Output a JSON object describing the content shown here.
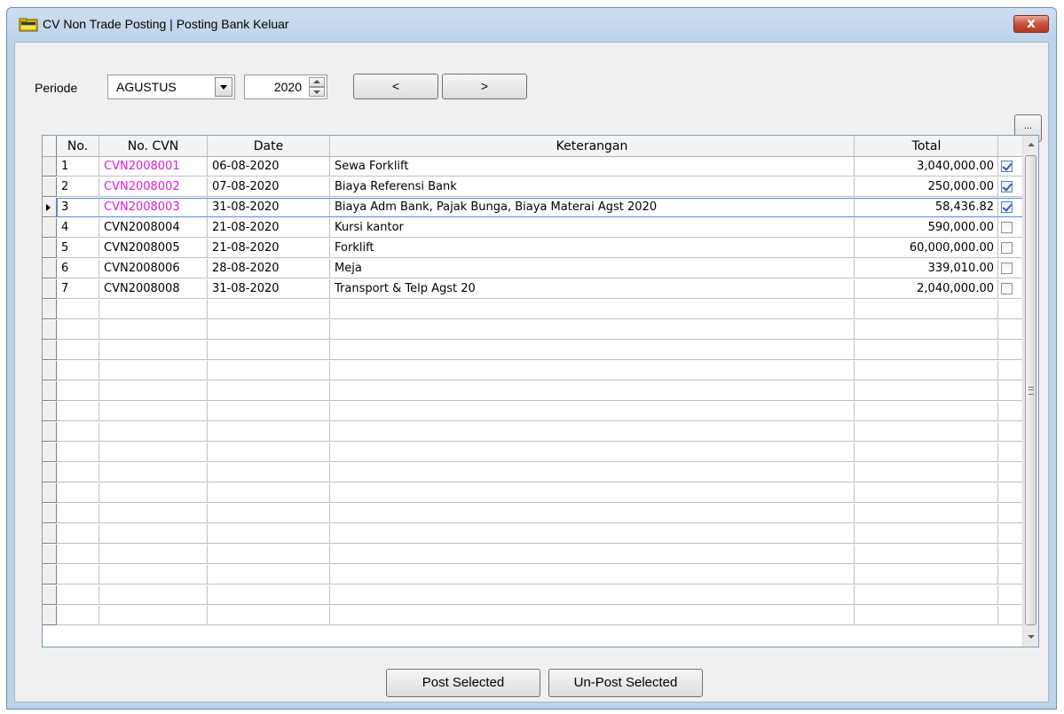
{
  "window": {
    "title": "CV Non Trade Posting | Posting Bank Keluar",
    "close_label": "x"
  },
  "toolbar": {
    "periode_label": "Periode",
    "month_value": "AGUSTUS",
    "year_value": "2020",
    "prev_label": "<",
    "next_label": ">",
    "more_label": "..."
  },
  "grid": {
    "columns": [
      "No.",
      "No. CVN",
      "Date",
      "Keterangan",
      "Total"
    ],
    "rows": [
      {
        "no": "1",
        "cvn": "CVN2008001",
        "date": "06-08-2020",
        "keterangan": "Sewa Forklift",
        "total": "3,040,000.00",
        "checked": true,
        "highlight": true
      },
      {
        "no": "2",
        "cvn": "CVN2008002",
        "date": "07-08-2020",
        "keterangan": "Biaya Referensi Bank",
        "total": "250,000.00",
        "checked": true,
        "highlight": true
      },
      {
        "no": "3",
        "cvn": "CVN2008003",
        "date": "31-08-2020",
        "keterangan": "Biaya Adm Bank, Pajak Bunga, Biaya Materai Agst 2020",
        "total": "58,436.82",
        "checked": true,
        "highlight": true,
        "current": true
      },
      {
        "no": "4",
        "cvn": "CVN2008004",
        "date": "21-08-2020",
        "keterangan": "Kursi kantor",
        "total": "590,000.00",
        "checked": false
      },
      {
        "no": "5",
        "cvn": "CVN2008005",
        "date": "21-08-2020",
        "keterangan": "Forklift",
        "total": "60,000,000.00",
        "checked": false
      },
      {
        "no": "6",
        "cvn": "CVN2008006",
        "date": "28-08-2020",
        "keterangan": "Meja",
        "total": "339,010.00",
        "checked": false
      },
      {
        "no": "7",
        "cvn": "CVN2008008",
        "date": "31-08-2020",
        "keterangan": "Transport & Telp Agst 20",
        "total": "2,040,000.00",
        "checked": false
      }
    ],
    "empty_rows": 16
  },
  "actions": {
    "post_label": "Post Selected",
    "unpost_label": "Un-Post Selected"
  },
  "colors": {
    "highlight_text": "#e01cd6",
    "title_bar": "#bcd2ea",
    "close_button": "#c6513c"
  }
}
